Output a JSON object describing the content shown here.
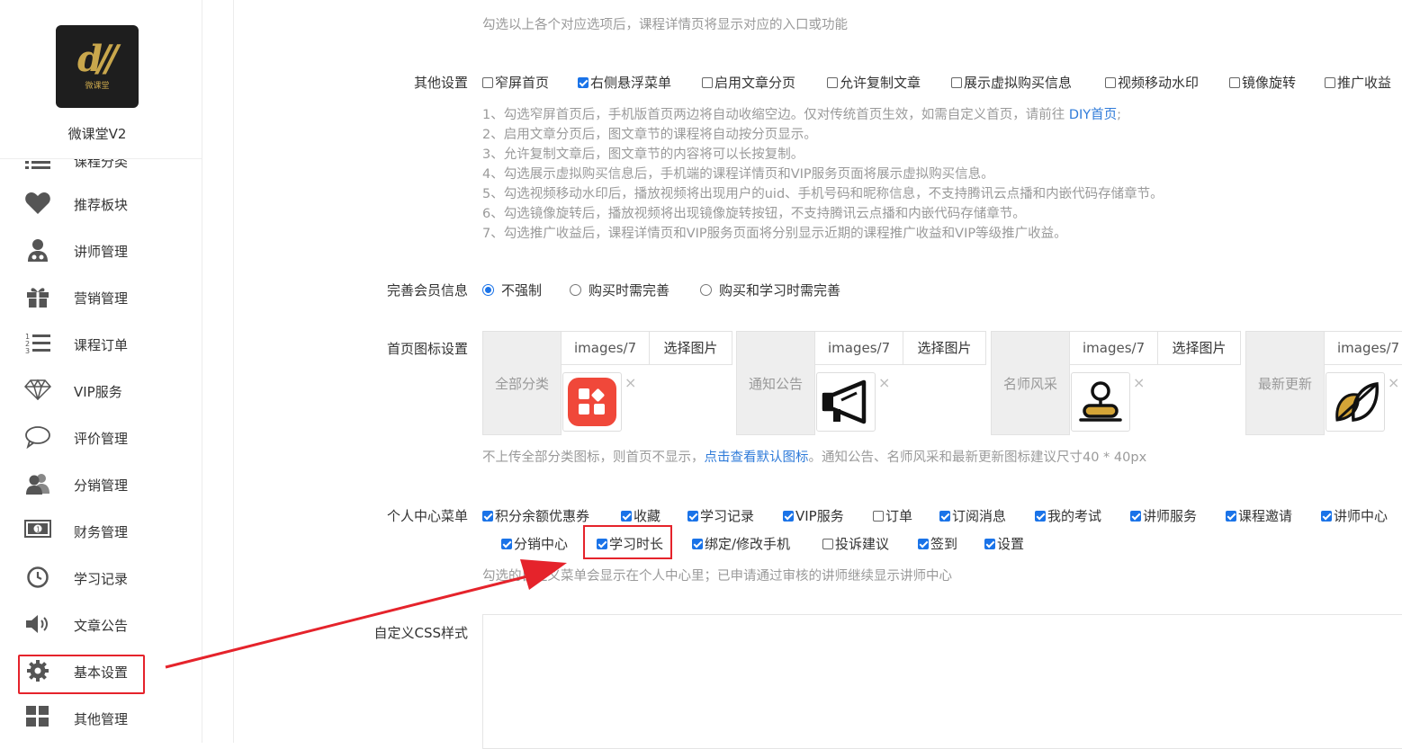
{
  "sidebar": {
    "logo_text": "微课堂",
    "app_name": "微课堂V2",
    "items": [
      {
        "label": "课程分类",
        "icon": "list-icon"
      },
      {
        "label": "推荐板块",
        "icon": "heart-icon"
      },
      {
        "label": "讲师管理",
        "icon": "teacher-icon"
      },
      {
        "label": "营销管理",
        "icon": "gift-icon"
      },
      {
        "label": "课程订单",
        "icon": "ordered-list-icon"
      },
      {
        "label": "VIP服务",
        "icon": "diamond-icon"
      },
      {
        "label": "评价管理",
        "icon": "comment-icon"
      },
      {
        "label": "分销管理",
        "icon": "users-icon"
      },
      {
        "label": "财务管理",
        "icon": "money-icon"
      },
      {
        "label": "学习记录",
        "icon": "clock-icon"
      },
      {
        "label": "文章公告",
        "icon": "speaker-icon"
      },
      {
        "label": "基本设置",
        "icon": "gear-icon"
      },
      {
        "label": "其他管理",
        "icon": "grid-icon"
      }
    ]
  },
  "top_hint": "勾选以上各个对应选项后，课程详情页将显示对应的入口或功能",
  "other_settings": {
    "label": "其他设置",
    "options": [
      {
        "label": "窄屏首页",
        "checked": false
      },
      {
        "label": "右侧悬浮菜单",
        "checked": true
      },
      {
        "label": "启用文章分页",
        "checked": false
      },
      {
        "label": "允许复制文章",
        "checked": false
      },
      {
        "label": "展示虚拟购买信息",
        "checked": false
      },
      {
        "label": "视频移动水印",
        "checked": false
      },
      {
        "label": "镜像旋转",
        "checked": false
      },
      {
        "label": "推广收益",
        "checked": false
      }
    ],
    "notes": [
      {
        "text": "1、勾选窄屏首页后，手机版首页两边将自动收缩空边。仅对传统首页生效，如需自定义首页，请前往 ",
        "link": "DIY首页",
        "suffix": ";"
      },
      {
        "text": "2、启用文章分页后，图文章节的课程将自动按分页显示。"
      },
      {
        "text": "3、允许复制文章后，图文章节的内容将可以长按复制。"
      },
      {
        "text": "4、勾选展示虚拟购买信息后，手机端的课程详情页和VIP服务页面将展示虚拟购买信息。"
      },
      {
        "text": "5、勾选视频移动水印后，播放视频将出现用户的uid、手机号码和昵称信息，不支持腾讯云点播和内嵌代码存储章节。"
      },
      {
        "text": "6、勾选镜像旋转后，播放视频将出现镜像旋转按钮，不支持腾讯云点播和内嵌代码存储章节。"
      },
      {
        "text": "7、勾选推广收益后，课程详情页和VIP服务页面将分别显示近期的课程推广收益和VIP等级推广收益。"
      }
    ]
  },
  "member_info": {
    "label": "完善会员信息",
    "options": [
      {
        "label": "不强制",
        "selected": true
      },
      {
        "label": "购买时需完善",
        "selected": false
      },
      {
        "label": "购买和学习时需完善",
        "selected": false
      }
    ]
  },
  "home_icons": {
    "label": "首页图标设置",
    "groups": [
      {
        "label": "全部分类",
        "path": "images/7",
        "button": "选择图片",
        "icon": "category-grid-icon"
      },
      {
        "label": "通知公告",
        "path": "images/7",
        "button": "选择图片",
        "icon": "megaphone-icon"
      },
      {
        "label": "名师风采",
        "path": "images/7",
        "button": "选择图片",
        "icon": "teacher-stamp-icon"
      },
      {
        "label": "最新更新",
        "path": "images/7",
        "button": "",
        "icon": "leaf-icon"
      }
    ],
    "remove_symbol": "×",
    "hint_prefix": "不上传全部分类图标，则首页不显示，",
    "hint_link": "点击查看默认图标",
    "hint_suffix": "。通知公告、名师风采和最新更新图标建议尺寸40 * 40px"
  },
  "personal_menu": {
    "label": "个人中心菜单",
    "options": [
      {
        "label": "积分余额优惠券",
        "checked": true
      },
      {
        "label": "收藏",
        "checked": true
      },
      {
        "label": "学习记录",
        "checked": true
      },
      {
        "label": "VIP服务",
        "checked": true
      },
      {
        "label": "订单",
        "checked": false
      },
      {
        "label": "订阅消息",
        "checked": true
      },
      {
        "label": "我的考试",
        "checked": true
      },
      {
        "label": "讲师服务",
        "checked": true
      },
      {
        "label": "课程邀请",
        "checked": true
      },
      {
        "label": "讲师中心",
        "checked": true
      },
      {
        "label": "分销中心",
        "checked": true
      },
      {
        "label": "学习时长",
        "checked": true
      },
      {
        "label": "绑定/修改手机",
        "checked": true
      },
      {
        "label": "投诉建议",
        "checked": false
      },
      {
        "label": "签到",
        "checked": true
      },
      {
        "label": "设置",
        "checked": true
      }
    ],
    "hint": "勾选的自定义菜单会显示在个人中心里；已申请通过审核的讲师继续显示讲师中心"
  },
  "custom_css": {
    "label": "自定义CSS样式"
  },
  "colors": {
    "accent": "#1a73e8",
    "highlight": "#e5232b",
    "link": "#2f7bd9"
  }
}
